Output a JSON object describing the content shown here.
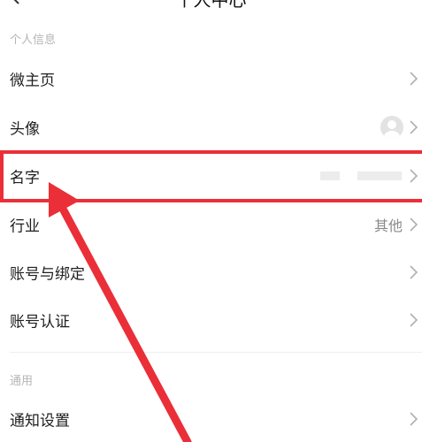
{
  "header": {
    "title": "个人中心",
    "back_icon": "chevron-left-icon"
  },
  "sections": [
    {
      "header": "个人信息"
    },
    {
      "header": "通用"
    }
  ],
  "rows": {
    "micro_homepage": {
      "label": "微主页",
      "icon": "chevron-right-icon"
    },
    "avatar": {
      "label": "头像",
      "icon": "avatar-placeholder-icon"
    },
    "name": {
      "label": "名字",
      "value_redacted": true
    },
    "industry": {
      "label": "行业",
      "value": "其他"
    },
    "account_binding": {
      "label": "账号与绑定"
    },
    "account_verification": {
      "label": "账号认证"
    },
    "notification_settings": {
      "label": "通知设置"
    }
  },
  "annotation": {
    "color": "#ea2f38",
    "highlighted_row": "name"
  }
}
